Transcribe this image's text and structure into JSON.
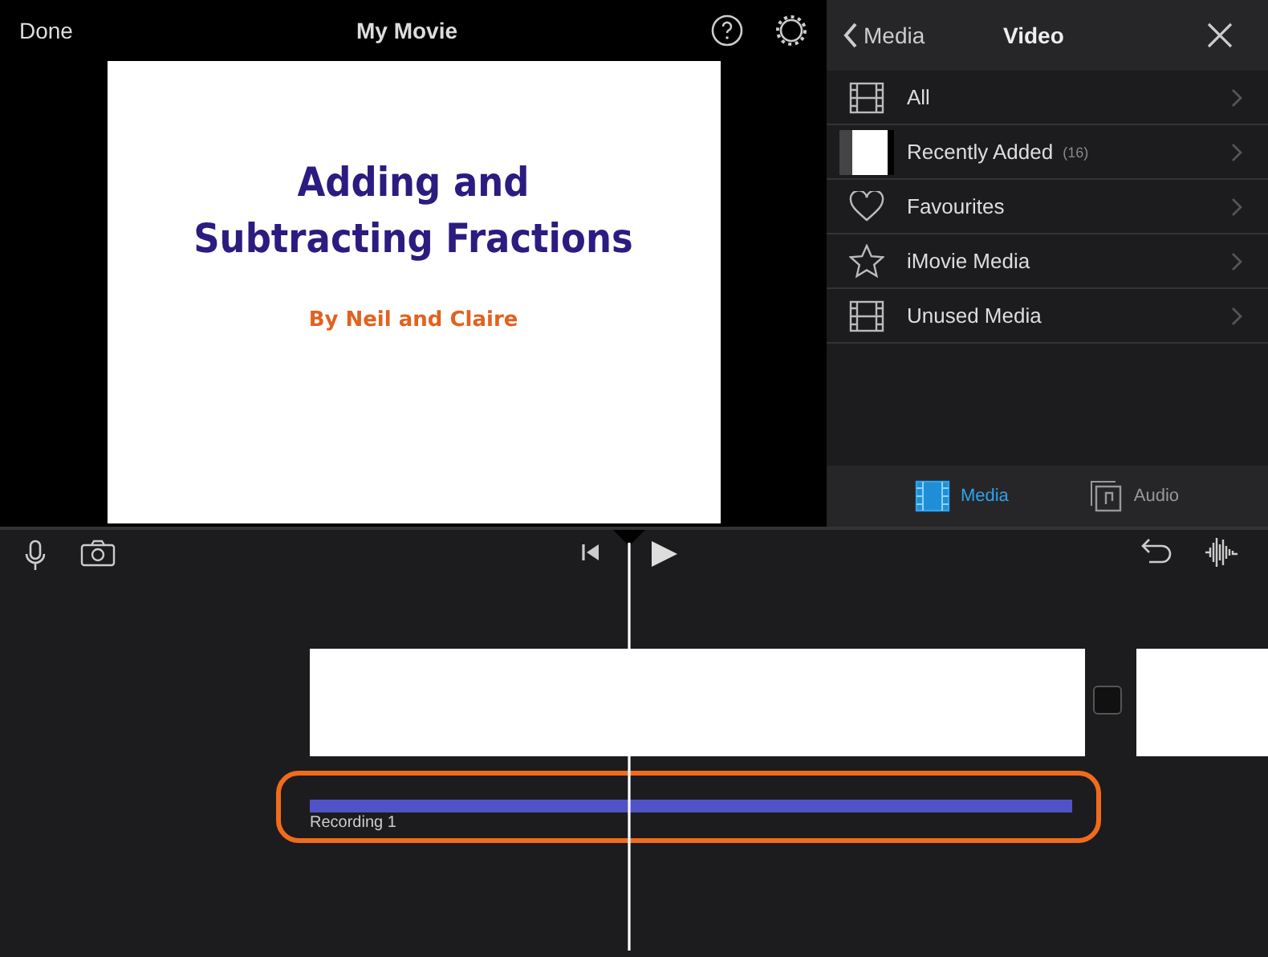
{
  "toolbar": {
    "done": "Done",
    "title": "My Movie"
  },
  "preview": {
    "title": "Adding and Subtracting Fractions",
    "byline": "By Neil and Claire"
  },
  "media_panel": {
    "back": "Media",
    "title": "Video",
    "items": [
      {
        "kind": "film",
        "label": "All"
      },
      {
        "kind": "thumbnail",
        "label": "Recently Added",
        "count": "(16)"
      },
      {
        "kind": "heart",
        "label": "Favourites"
      },
      {
        "kind": "star",
        "label": "iMovie Media"
      },
      {
        "kind": "film",
        "label": "Unused Media"
      }
    ],
    "tabs": [
      {
        "kind": "media",
        "label": "Media",
        "selected": true
      },
      {
        "kind": "audio",
        "label": "Audio",
        "selected": false
      }
    ]
  },
  "timeline": {
    "audio_clip": {
      "label": "Recording 1"
    }
  }
}
